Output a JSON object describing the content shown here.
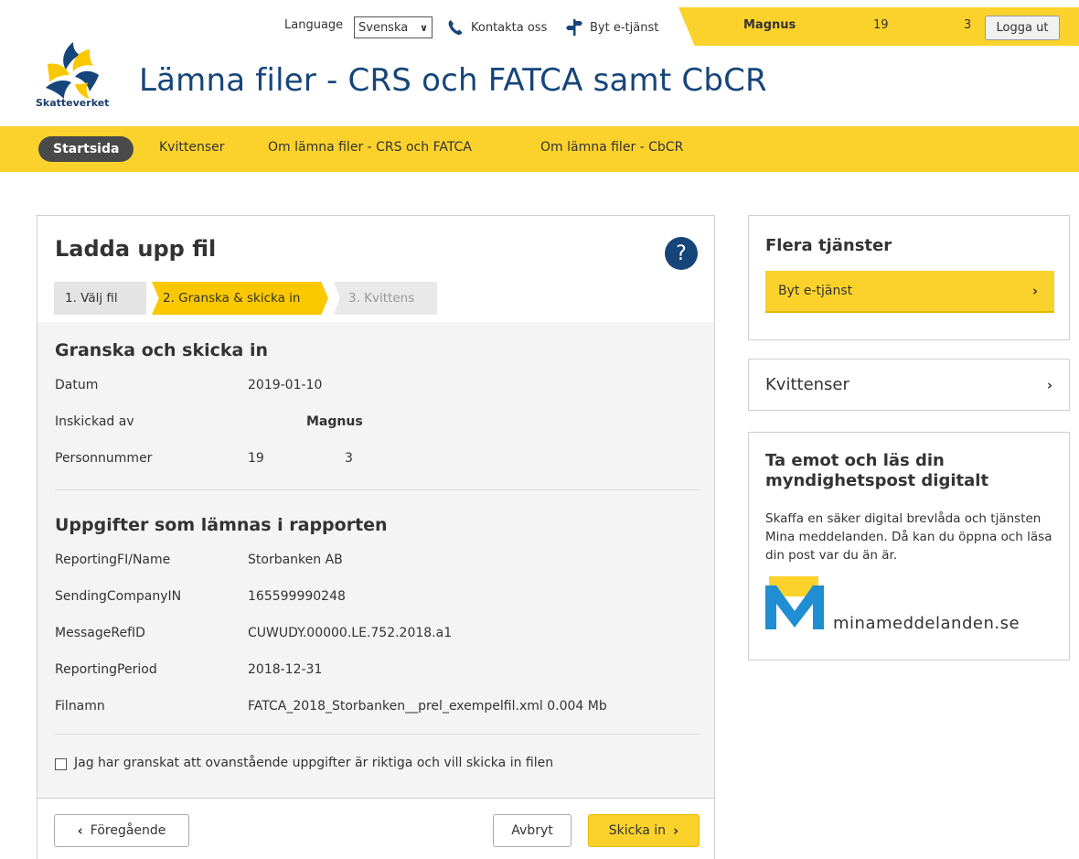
{
  "topbar": {
    "language_label": "Language",
    "language_value": "Svenska",
    "contact_label": "Kontakta oss",
    "switch_service_label": "Byt e-tjänst",
    "user_name": "Magnus",
    "user_pnr_part1": "19",
    "user_pnr_part2": "3",
    "logout_label": "Logga ut"
  },
  "header": {
    "logo_text": "Skatteverket",
    "title": "Lämna filer - CRS och FATCA samt CbCR"
  },
  "nav": {
    "items": [
      {
        "label": "Startsida"
      },
      {
        "label": "Kvittenser"
      },
      {
        "label": "Om lämna filer - CRS och FATCA"
      },
      {
        "label": "Om lämna filer - CbCR"
      }
    ]
  },
  "main": {
    "title": "Ladda upp fil",
    "help_symbol": "?",
    "steps": [
      {
        "label": "1.  Välj fil"
      },
      {
        "label": "2. Granska & skicka in"
      },
      {
        "label": "3. Kvittens"
      }
    ],
    "review_title": "Granska och skicka in",
    "review_rows": [
      {
        "label": "Datum",
        "value": "2019-01-10"
      },
      {
        "label": "Inskickad av",
        "value": "Magnus"
      },
      {
        "label": "Personnummer",
        "value1": "19",
        "value2": "3"
      }
    ],
    "report_title": "Uppgifter som lämnas i rapporten",
    "report_rows": [
      {
        "label": "ReportingFI/Name",
        "value": "Storbanken AB"
      },
      {
        "label": "SendingCompanyIN",
        "value": "165599990248"
      },
      {
        "label": "MessageRefID",
        "value": "CUWUDY.00000.LE.752.2018.a1"
      },
      {
        "label": "ReportingPeriod",
        "value": "2018-12-31"
      },
      {
        "label": "Filnamn",
        "value": "FATCA_2018_Storbanken__prel_exempelfil.xml  0.004 Mb"
      }
    ],
    "confirm_label": "Jag har granskat att ovanstående uppgifter är riktiga och vill skicka in filen",
    "prev_label": "Föregående",
    "cancel_label": "Avbryt",
    "submit_label": "Skicka in"
  },
  "side": {
    "more_services_title": "Flera tjänster",
    "switch_service_btn": "Byt e-tjänst",
    "receipts_title": "Kvittenser",
    "promo_title": "Ta emot och läs din myndighetspost digitalt",
    "promo_text": "Skaffa en säker digital brevlåda och tjänsten Mina meddelanden. Då kan du öppna och läsa din post var du än är.",
    "promo_logo_text": "minameddelanden.se"
  },
  "colors": {
    "brand_yellow": "#fbd22c",
    "brand_blue": "#16457a",
    "step_active": "#fbc800"
  }
}
